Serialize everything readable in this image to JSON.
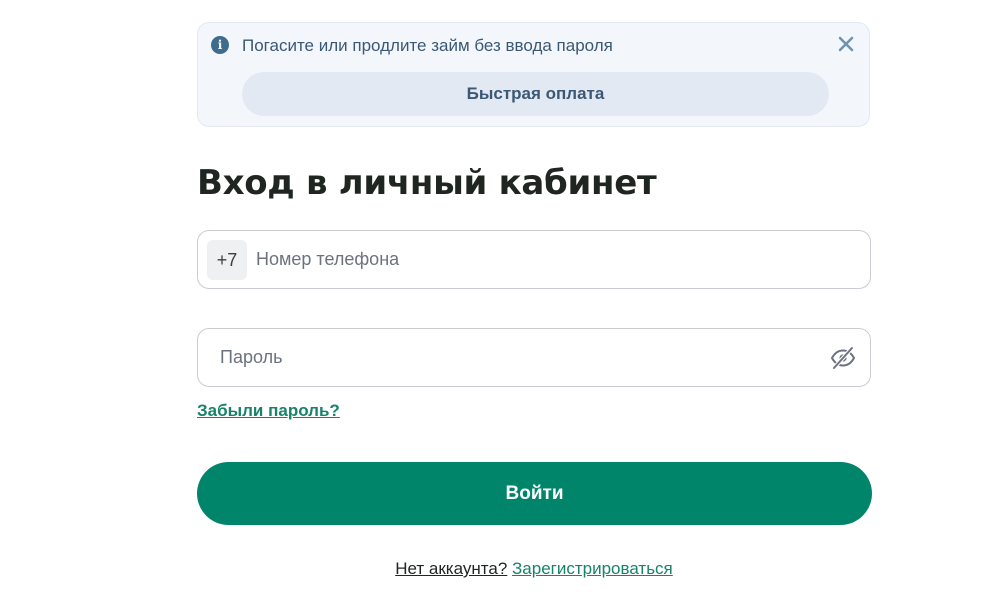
{
  "banner": {
    "info_icon": "info-icon",
    "text": "Погасите или продлите займ без ввода пароля",
    "close_icon": "close-icon",
    "quick_pay_label": "Быстрая оплата"
  },
  "login": {
    "title": "Вход в личный кабинет",
    "phone": {
      "prefix": "+7",
      "placeholder": "Номер телефона",
      "value": ""
    },
    "password": {
      "placeholder": "Пароль",
      "value": "",
      "toggle_icon": "eye-slash-icon"
    },
    "forgot_label": "Забыли пароль?",
    "submit_label": "Войти",
    "register_question": "Нет аккаунта?",
    "register_label": "Зарегистрироваться"
  },
  "colors": {
    "accent": "#00856a",
    "link": "#17836a",
    "banner_bg": "#f3f7fc",
    "banner_text": "#3b5874"
  }
}
